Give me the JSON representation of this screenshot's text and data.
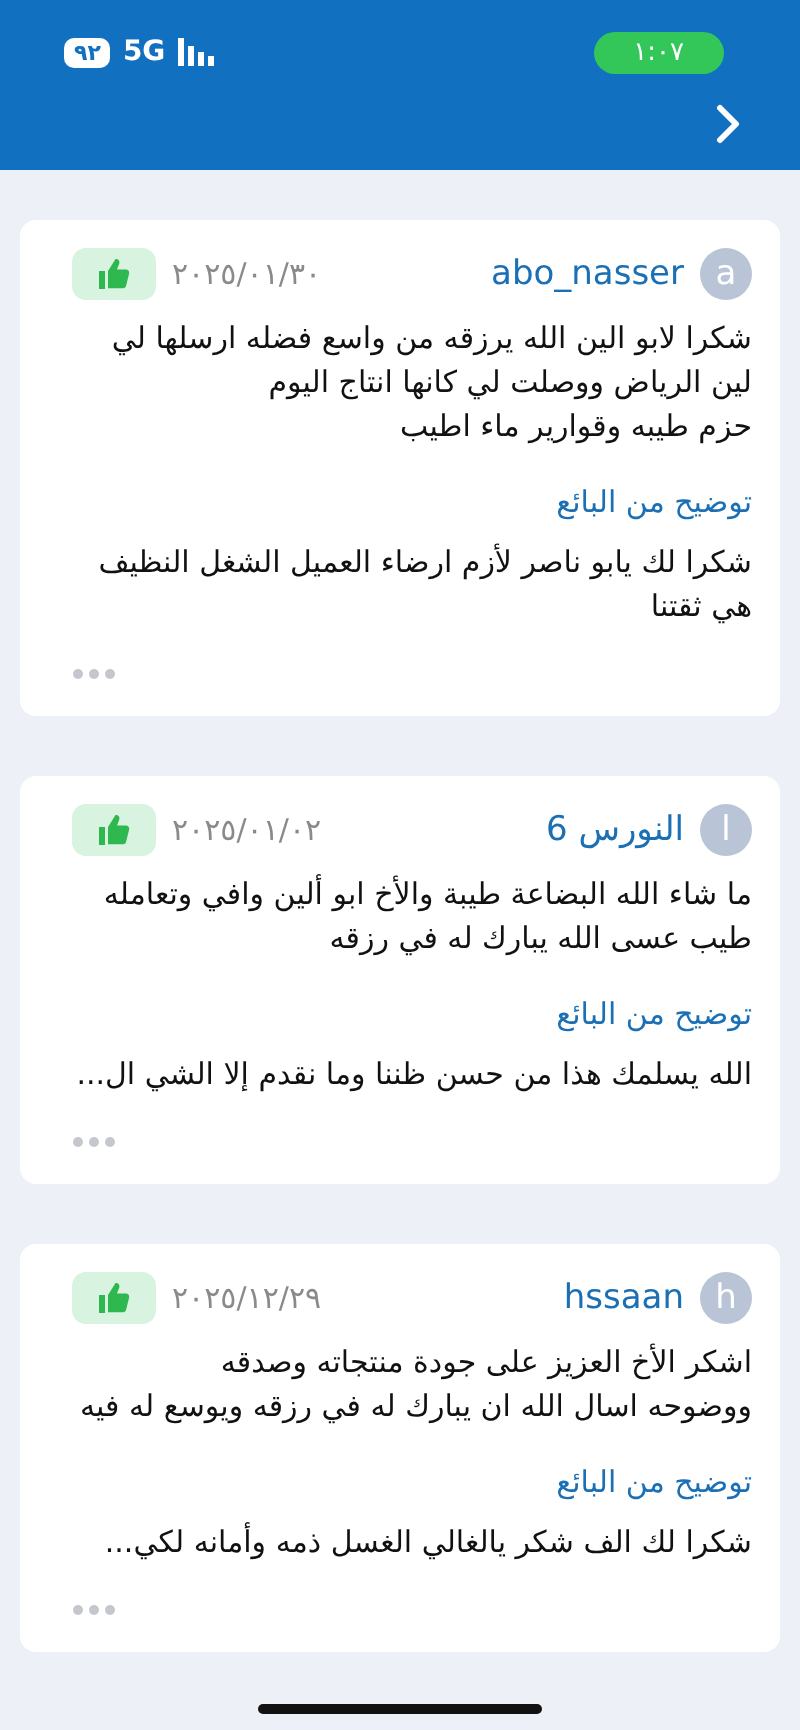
{
  "status_bar": {
    "time": "١:٠٧",
    "battery": "٩٢",
    "network": "5G"
  },
  "reviews": [
    {
      "avatar": "a",
      "user": "abo_nasser",
      "date": "٢٠٢٥/٠١/٣٠",
      "liked": true,
      "comment": "شكرا لابو الين الله يرزقه من واسع فضله ارسلها لي\nلين الرياض ووصلت لي كانها انتاج اليوم\nحزم طيبه وقوارير ماء  اطيب",
      "reply_title": "توضيح من البائع",
      "reply": "شكرا لك يابو ناصر لأزم ارضاء العميل الشغل النظيف\nهي ثقتنا"
    },
    {
      "avatar": "ا",
      "user": "النورس 6",
      "date": "٢٠٢٥/٠١/٠٢",
      "liked": true,
      "comment": "ما شاء الله البضاعة طيبة والأخ ابو ألين وافي وتعامله\nطيب عسى الله يبارك له في رزقه",
      "reply_title": "توضيح من البائع",
      "reply": "الله يسلمك هذا من حسن ظننا وما نقدم إلا الشي ال..."
    },
    {
      "avatar": "h",
      "user": "hssaan",
      "date": "٢٠٢٥/١٢/٢٩",
      "liked": true,
      "comment": "اشكر الأخ العزيز على جودة منتجاته وصدقه\nووضوحه اسال الله ان يبارك له في رزقه ويوسع له فيه",
      "reply_title": "توضيح من البائع",
      "reply": "شكرا لك الف شكر يالغالي الغسل ذمه وأمانه لكي..."
    }
  ]
}
